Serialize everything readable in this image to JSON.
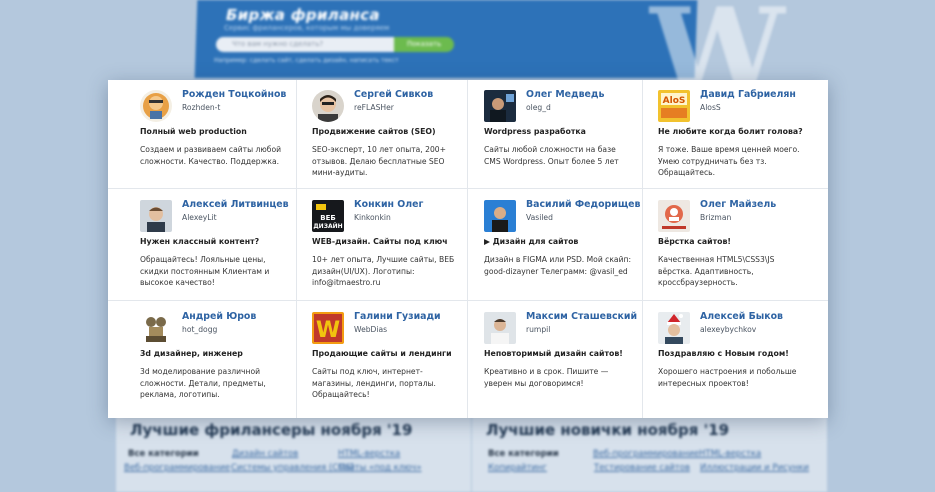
{
  "hero": {
    "title": "Биржа фриланса",
    "subtitle": "Сервис фрилансеров, которым мы доверяем",
    "search_placeholder": "Что вам нужно сделать?",
    "search_button": "Показать",
    "hint": "Например: сделать сайт, сделать дизайн, написать текст"
  },
  "cards": [
    {
      "name": "Рожден Тоцкойнов",
      "login": "Rozhden-t",
      "headline": "Полный web production",
      "desc": "Создаем и развиваем сайты любой сложности. Качество. Поддержка."
    },
    {
      "name": "Сергей Сивков",
      "login": "reFLASHer",
      "headline": "Продвижение сайтов (SEO)",
      "desc": "SEO-эксперт, 10 лет опыта, 200+ отзывов. Делаю бесплатные SEO мини-аудиты."
    },
    {
      "name": "Олег Медведь",
      "login": "oleg_d",
      "headline": "Wordpress разработка",
      "desc": "Сайты любой сложности на базе CMS Wordpress. Опыт более 5 лет"
    },
    {
      "name": "Давид Габриелян",
      "login": "AlosS",
      "headline": "Не любите когда болит голова?",
      "desc": "Я тоже. Ваше время ценней моего. Умею сотрудничать без тз. Обращайтесь."
    },
    {
      "name": "Алексей Литвинцев",
      "login": "AlexeyLit",
      "headline": "Нужен классный контент?",
      "desc": "Обращайтесь! Лояльные цены, скидки постоянным Клиентам и высокое качество!"
    },
    {
      "name": "Конкин Олег",
      "login": "Kinkonkin",
      "headline": "WEB-дизайн. Сайты под ключ",
      "desc": "10+ лет опыта, Лучшие сайты, ВЕБ дизайн(UI/UX). Логотипы: info@itmaestro.ru"
    },
    {
      "name": "Василий Федорищев",
      "login": "Vasiled",
      "headline": "▶ Дизайн для сайтов",
      "desc": "Дизайн в FIGMA или PSD. Мой скайп: good-dizayner Телеграмм: @vasil_ed"
    },
    {
      "name": "Олег Майзель",
      "login": "Brizman",
      "headline": "Вёрстка сайтов!",
      "desc": "Качественная HTML5\\CSS3\\JS вёрстка. Адаптивность, кроссбраузерность."
    },
    {
      "name": "Андрей Юров",
      "login": "hot_dogg",
      "headline": "3d дизайнер, инженер",
      "desc": "3d моделирование различной сложности. Детали, предметы, реклама, логотипы."
    },
    {
      "name": "Галини Гузиади",
      "login": "WebDias",
      "headline": "Продающие сайты и лендинги",
      "desc": "Сайты под ключ, интернет-магазины, лендинги, порталы. Обращайтесь!"
    },
    {
      "name": "Максим Сташевский",
      "login": "rumpil",
      "headline": "Неповторимый дизайн сайтов!",
      "desc": "Креативно и в срок. Пишите — уверен мы договоримся!"
    },
    {
      "name": "Алексей Быков",
      "login": "alexeybychkov",
      "headline": "Поздравляю с Новым годом!",
      "desc": "Хорошего настроения и побольше интересных проектов!"
    }
  ],
  "lower": {
    "left_title": "Лучшие фрилансеры ноября '19",
    "right_title": "Лучшие новички ноября '19",
    "left_links": [
      "Все категории",
      "Дизайн сайтов",
      "HTML-верстка",
      "Веб-программирование",
      "Системы управления (CMS)",
      "Сайты «под ключ»"
    ],
    "right_links": [
      "Все категории",
      "Веб-программирование",
      "HTML-верстка",
      "Копирайтинг",
      "Тестирование сайтов",
      "Иллюстрации и Рисунки"
    ]
  },
  "colors": {
    "accent": "#2e63a3",
    "hero": "#2d72b8",
    "button": "#6cbb4e"
  }
}
